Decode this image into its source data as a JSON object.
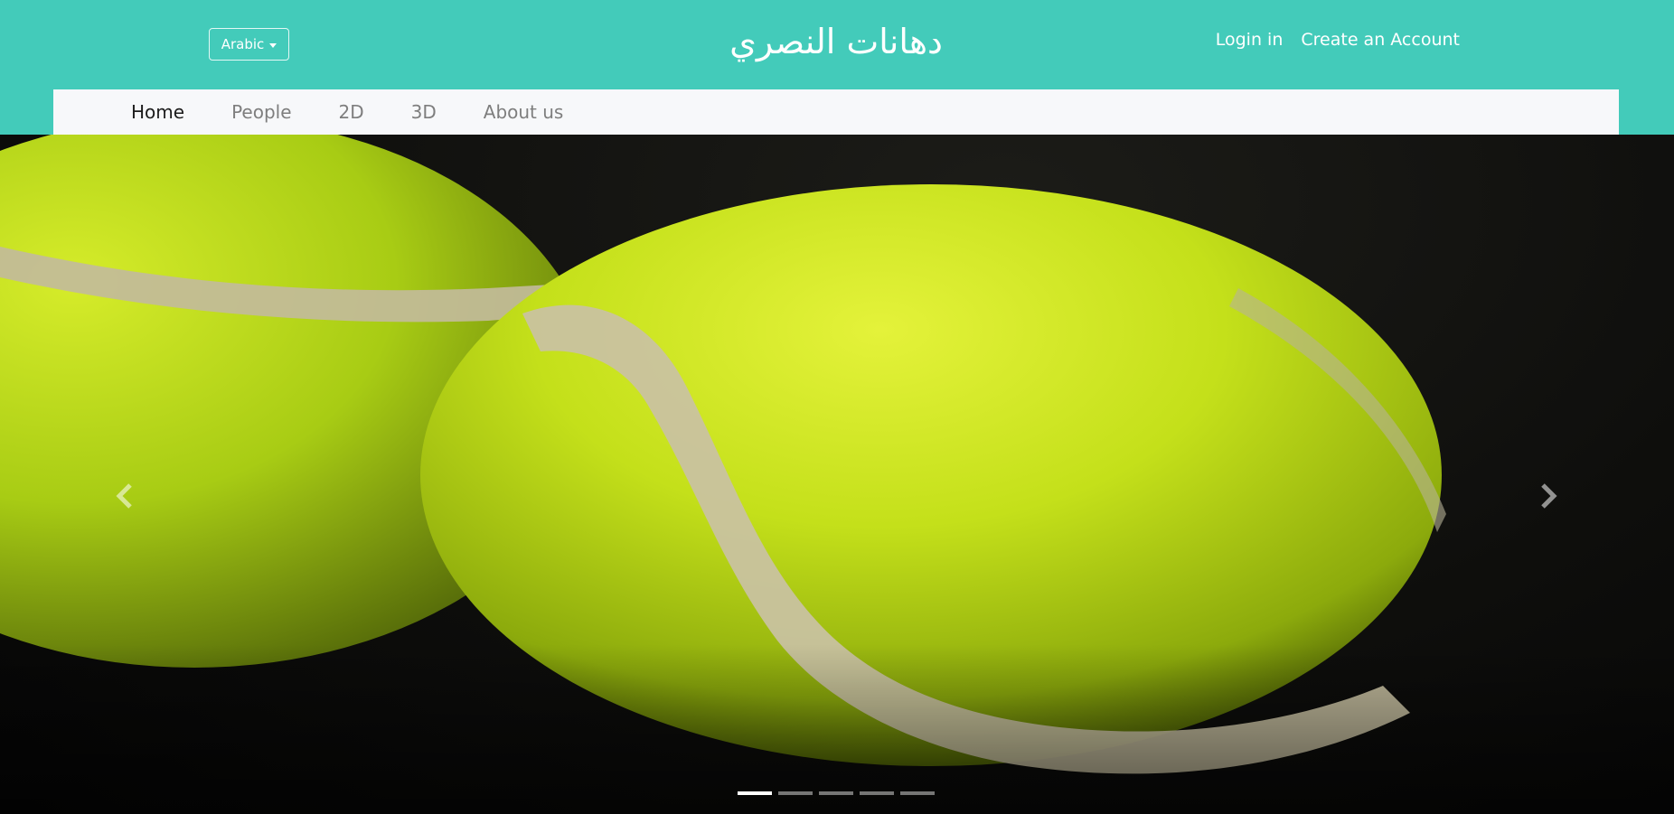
{
  "header": {
    "language_button": "Arabic",
    "site_title": "دهانات النصري",
    "login_label": "Login in",
    "create_account_label": "Create an Account",
    "background_color": "#43cbba"
  },
  "nav": {
    "items": [
      {
        "label": "Home",
        "active": true
      },
      {
        "label": "People",
        "active": false
      },
      {
        "label": "2D",
        "active": false
      },
      {
        "label": "3D",
        "active": false
      },
      {
        "label": "About us",
        "active": false
      }
    ]
  },
  "carousel": {
    "prev_icon": "chevron-left-icon",
    "next_icon": "chevron-right-icon",
    "slide_count": 5,
    "active_slide": 1
  }
}
